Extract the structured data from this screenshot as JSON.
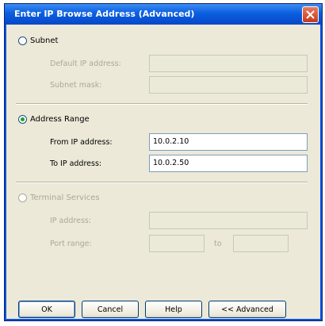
{
  "window": {
    "title": "Enter IP Browse Address (Advanced)"
  },
  "subnet": {
    "label": "Subnet",
    "selected": false,
    "default_ip_label": "Default IP address:",
    "subnet_mask_label": "Subnet mask:",
    "default_ip_value": "",
    "subnet_mask_value": ""
  },
  "address_range": {
    "label": "Address Range",
    "selected": true,
    "from_label": "From IP address:",
    "to_label": "To IP address:",
    "from_value": "10.0.2.10",
    "to_value": "10.0.2.50"
  },
  "terminal_services": {
    "label": "Terminal Services",
    "selected": false,
    "ip_label": "IP address:",
    "ports_label": "Port range:",
    "ip_value": "",
    "port_from_value": "",
    "port_to_value": "",
    "port_separator": "to"
  },
  "buttons": {
    "ok": "OK",
    "cancel": "Cancel",
    "help": "Help",
    "advanced": "<< Advanced"
  }
}
